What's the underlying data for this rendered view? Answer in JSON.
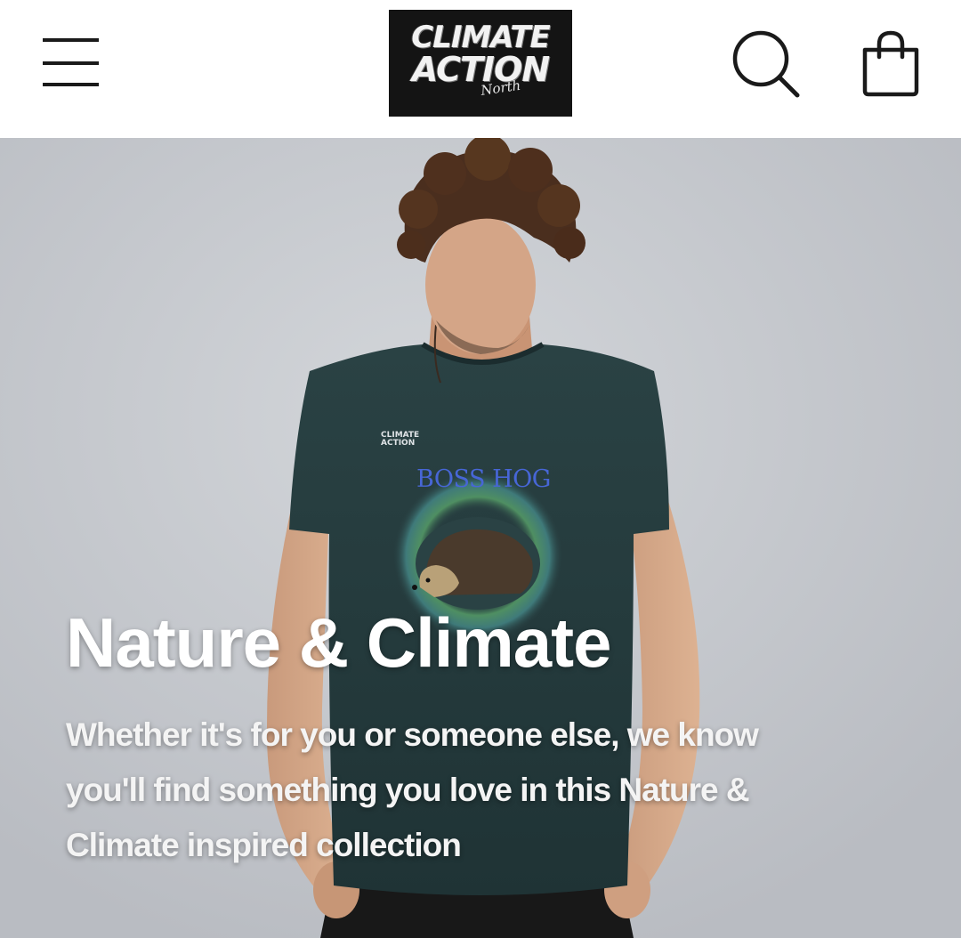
{
  "header": {
    "menu_icon": "hamburger-menu-icon",
    "search_icon": "search-icon",
    "cart_icon": "shopping-bag-icon",
    "logo": {
      "line1": "CLIMATE",
      "line2": "ACTION",
      "line3": "North"
    }
  },
  "hero": {
    "shirt_brand": "CLIMATE ACTION",
    "shirt_title": "BOSS HOG",
    "title": "Nature & Climate",
    "description": "Whether it's for you or someone else, we know you'll find something you love in this Nature & Climate inspired collection"
  },
  "colors": {
    "header_bg": "#ffffff",
    "icon_stroke": "#1a1a1a",
    "logo_bg": "#141414",
    "hero_bg": "#c6c9ce",
    "shirt": "#243a3c",
    "shirt_title": "#4766d6",
    "hero_text": "#ffffff"
  }
}
